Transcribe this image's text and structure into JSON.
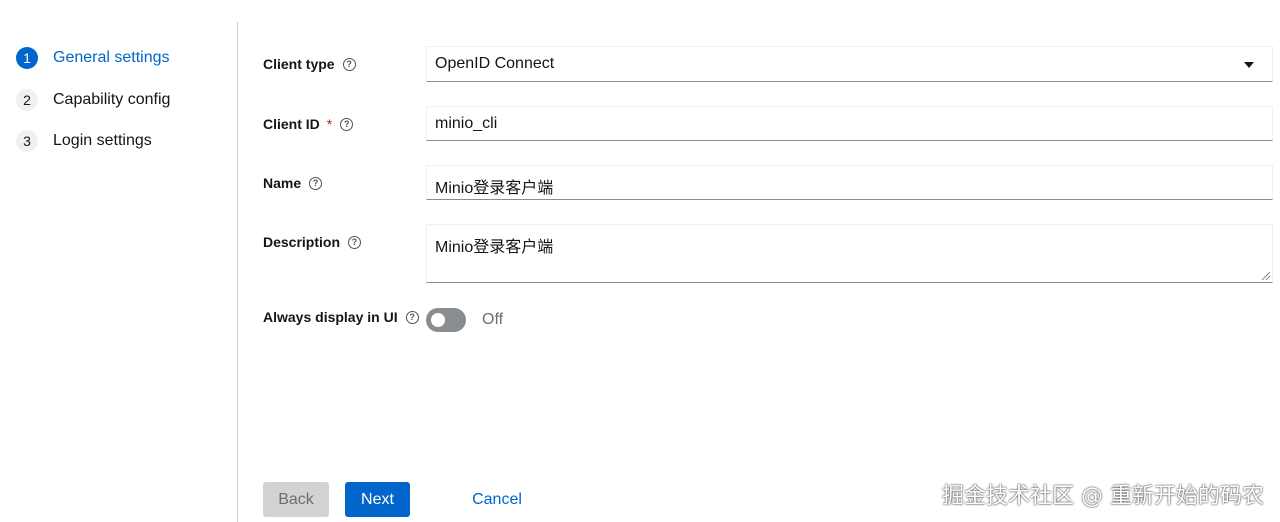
{
  "wizard": {
    "steps": [
      {
        "num": "1",
        "label": "General settings"
      },
      {
        "num": "2",
        "label": "Capability config"
      },
      {
        "num": "3",
        "label": "Login settings"
      }
    ]
  },
  "form": {
    "client_type": {
      "label": "Client type",
      "value": "OpenID Connect"
    },
    "client_id": {
      "label": "Client ID",
      "required_mark": "*",
      "value": "minio_cli"
    },
    "name": {
      "label": "Name",
      "value": "Minio登录客户端"
    },
    "description": {
      "label": "Description",
      "value": "Minio登录客户端"
    },
    "always_display": {
      "label": "Always display in UI",
      "state_text": "Off"
    }
  },
  "help_icon_glyph": "?",
  "footer": {
    "back_label": "Back",
    "next_label": "Next",
    "cancel_label": "Cancel"
  },
  "watermark": "掘金技术社区 @ 重新开始的码农",
  "colors": {
    "accent": "#0066cc",
    "required": "#c9190b",
    "switch_off": "#8a8d90",
    "disabled_button": "#d2d2d2"
  }
}
